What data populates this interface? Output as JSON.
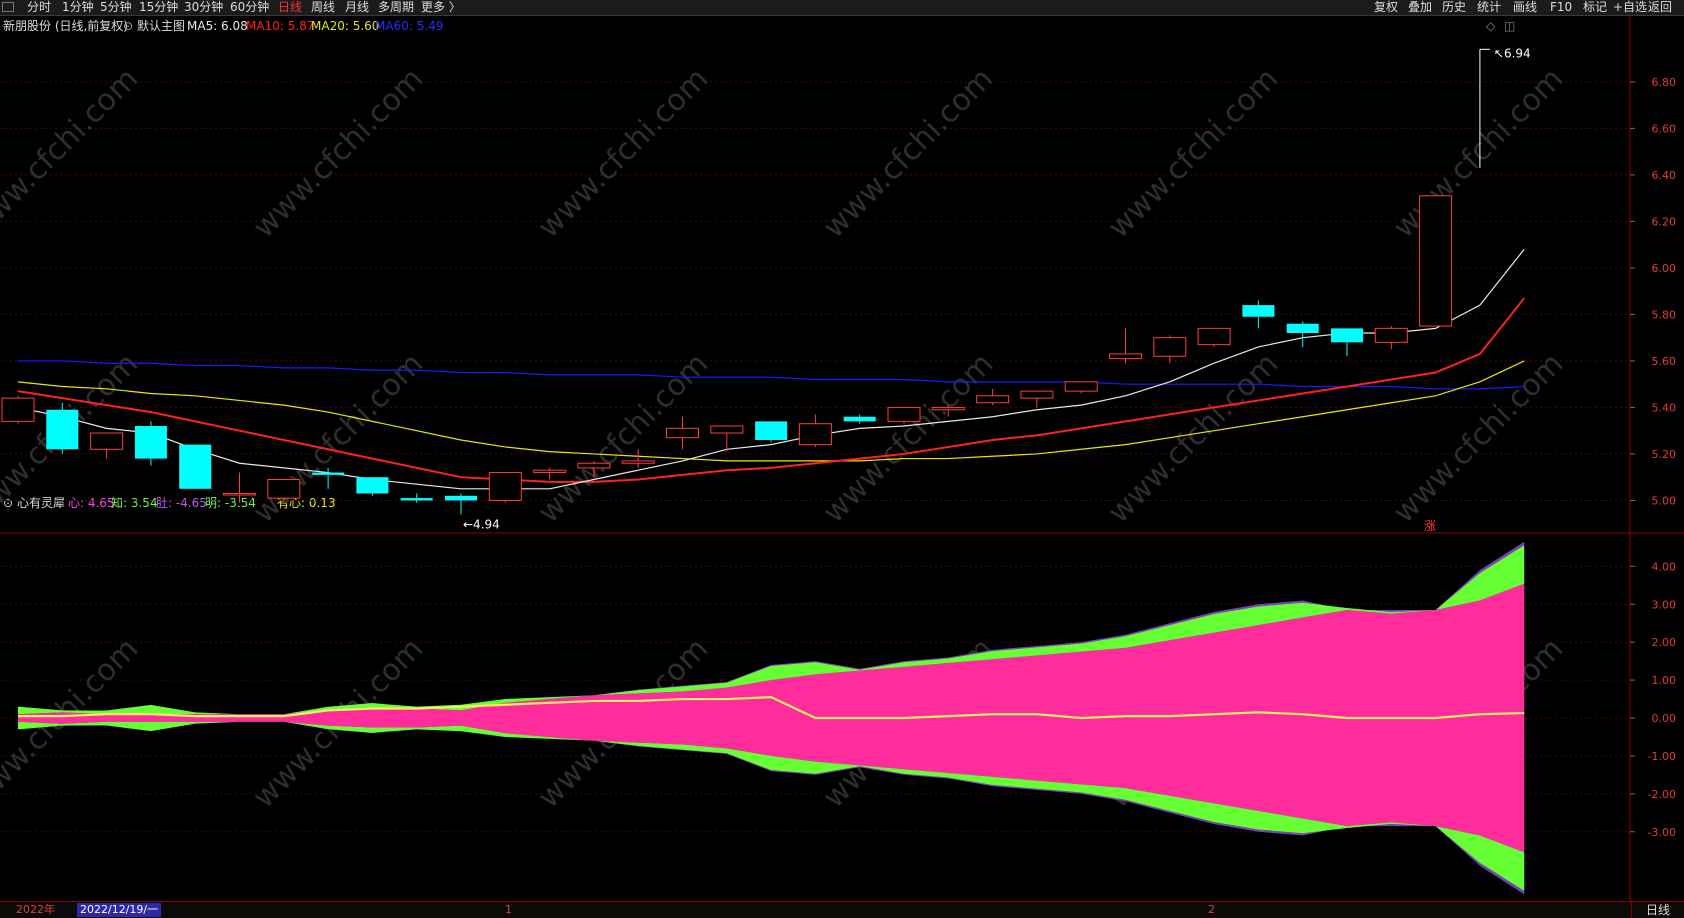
{
  "toolbar": {
    "left_items": [
      {
        "label": "分时",
        "active": false
      },
      {
        "label": "1分钟",
        "active": false
      },
      {
        "label": "5分钟",
        "active": false
      },
      {
        "label": "15分钟",
        "active": false
      },
      {
        "label": "30分钟",
        "active": false
      },
      {
        "label": "60分钟",
        "active": false
      },
      {
        "label": "日线",
        "active": true
      },
      {
        "label": "周线",
        "active": false
      },
      {
        "label": "月线",
        "active": false
      },
      {
        "label": "多周期",
        "active": false
      },
      {
        "label": "更多 〉",
        "active": false
      }
    ],
    "right_items": [
      "复权",
      "叠加",
      "历史",
      "统计",
      "画线",
      "F10",
      "标记",
      "+自选",
      "返回"
    ]
  },
  "main_chart": {
    "stock_label": "新朋股份 (日线,前复权)",
    "template_label": "默认主图",
    "ma5_label": "MA5: 6.08",
    "ma10_label": "MA10: 5.87",
    "ma20_label": "MA20: 5.60",
    "ma60_label": "MA60: 5.49",
    "high_marker": "6.94",
    "low_marker": "4.94",
    "rise_badge": "涨"
  },
  "indicator_panel": {
    "name": "心有灵犀",
    "xin_label": "心: 4.65",
    "zhi_label": "知: 3.54",
    "du_label": "肚: -4.65",
    "ming_label": "明: -3.54",
    "youxin_label": "有心: 0.13"
  },
  "watermark_text": "www.cfchi.com",
  "bottom_bar": {
    "year": "2022年",
    "date": "2022/12/19/一",
    "month_markers": [
      "1",
      "2"
    ],
    "period": "日线"
  },
  "colors": {
    "up": "#ff3c3c",
    "down": "#00ffff",
    "ma5": "#e8e8e8",
    "ma10": "#ff2020",
    "ma20": "#e8e800",
    "ma60": "#1a1aff",
    "magenta": "#ff2c9c",
    "purple": "#7b3fb8",
    "green": "#66ff33",
    "axis": "#e23c3c"
  },
  "chart_data": {
    "type": "candlestick",
    "price_axis": {
      "ticks": [
        "6.80",
        "6.60",
        "6.40",
        "6.20",
        "6.00",
        "5.80",
        "5.60",
        "5.40",
        "5.20",
        "5.00"
      ],
      "range": [
        4.86,
        6.98
      ]
    },
    "candles": [
      {
        "o": 5.34,
        "h": 5.45,
        "l": 5.33,
        "c": 5.44
      },
      {
        "o": 5.39,
        "h": 5.42,
        "l": 5.2,
        "c": 5.22
      },
      {
        "o": 5.22,
        "h": 5.29,
        "l": 5.18,
        "c": 5.29
      },
      {
        "o": 5.32,
        "h": 5.34,
        "l": 5.15,
        "c": 5.18
      },
      {
        "o": 5.24,
        "h": 5.24,
        "l": 5.05,
        "c": 5.05
      },
      {
        "o": 5.03,
        "h": 5.12,
        "l": 4.99,
        "c": 5.03
      },
      {
        "o": 5.01,
        "h": 5.09,
        "l": 5.0,
        "c": 5.09
      },
      {
        "o": 5.12,
        "h": 5.14,
        "l": 5.05,
        "c": 5.11
      },
      {
        "o": 5.1,
        "h": 5.1,
        "l": 5.02,
        "c": 5.03
      },
      {
        "o": 5.01,
        "h": 5.03,
        "l": 4.99,
        "c": 5.0
      },
      {
        "o": 5.02,
        "h": 5.03,
        "l": 4.94,
        "c": 5.0
      },
      {
        "o": 5.0,
        "h": 5.12,
        "l": 4.99,
        "c": 5.12
      },
      {
        "o": 5.12,
        "h": 5.14,
        "l": 5.09,
        "c": 5.13
      },
      {
        "o": 5.14,
        "h": 5.17,
        "l": 5.1,
        "c": 5.16
      },
      {
        "o": 5.16,
        "h": 5.22,
        "l": 5.14,
        "c": 5.17
      },
      {
        "o": 5.27,
        "h": 5.36,
        "l": 5.22,
        "c": 5.31
      },
      {
        "o": 5.29,
        "h": 5.32,
        "l": 5.21,
        "c": 5.32
      },
      {
        "o": 5.34,
        "h": 5.34,
        "l": 5.25,
        "c": 5.26
      },
      {
        "o": 5.24,
        "h": 5.37,
        "l": 5.23,
        "c": 5.33
      },
      {
        "o": 5.36,
        "h": 5.37,
        "l": 5.33,
        "c": 5.34
      },
      {
        "o": 5.34,
        "h": 5.4,
        "l": 5.33,
        "c": 5.4
      },
      {
        "o": 5.39,
        "h": 5.41,
        "l": 5.36,
        "c": 5.4
      },
      {
        "o": 5.42,
        "h": 5.48,
        "l": 5.41,
        "c": 5.45
      },
      {
        "o": 5.44,
        "h": 5.47,
        "l": 5.4,
        "c": 5.47
      },
      {
        "o": 5.47,
        "h": 5.51,
        "l": 5.46,
        "c": 5.51
      },
      {
        "o": 5.61,
        "h": 5.74,
        "l": 5.59,
        "c": 5.63
      },
      {
        "o": 5.62,
        "h": 5.71,
        "l": 5.59,
        "c": 5.7
      },
      {
        "o": 5.67,
        "h": 5.74,
        "l": 5.66,
        "c": 5.74
      },
      {
        "o": 5.84,
        "h": 5.86,
        "l": 5.74,
        "c": 5.79
      },
      {
        "o": 5.76,
        "h": 5.77,
        "l": 5.66,
        "c": 5.72
      },
      {
        "o": 5.74,
        "h": 5.74,
        "l": 5.62,
        "c": 5.68
      },
      {
        "o": 5.68,
        "h": 5.75,
        "l": 5.65,
        "c": 5.74
      },
      {
        "o": 5.75,
        "h": 6.31,
        "l": 5.75,
        "c": 6.31
      },
      {
        "o": 6.94,
        "h": 6.94,
        "l": 6.43,
        "c": 6.43
      }
    ],
    "ma5": [
      5.4,
      5.36,
      5.31,
      5.29,
      5.22,
      5.16,
      5.14,
      5.12,
      5.09,
      5.07,
      5.05,
      5.05,
      5.05,
      5.09,
      5.13,
      5.17,
      5.22,
      5.24,
      5.28,
      5.31,
      5.32,
      5.34,
      5.36,
      5.39,
      5.41,
      5.45,
      5.51,
      5.59,
      5.66,
      5.7,
      5.72,
      5.72,
      5.74,
      5.84,
      6.08
    ],
    "ma10": [
      5.47,
      5.44,
      5.41,
      5.38,
      5.34,
      5.3,
      5.26,
      5.22,
      5.18,
      5.14,
      5.1,
      5.09,
      5.08,
      5.08,
      5.09,
      5.11,
      5.13,
      5.14,
      5.16,
      5.18,
      5.2,
      5.23,
      5.26,
      5.28,
      5.31,
      5.34,
      5.37,
      5.4,
      5.43,
      5.46,
      5.49,
      5.52,
      5.55,
      5.63,
      5.87
    ],
    "ma20": [
      5.51,
      5.49,
      5.48,
      5.46,
      5.45,
      5.43,
      5.41,
      5.38,
      5.34,
      5.3,
      5.26,
      5.23,
      5.21,
      5.2,
      5.19,
      5.18,
      5.17,
      5.17,
      5.17,
      5.17,
      5.18,
      5.18,
      5.19,
      5.2,
      5.22,
      5.24,
      5.27,
      5.3,
      5.33,
      5.36,
      5.39,
      5.42,
      5.45,
      5.51,
      5.6
    ],
    "ma60": [
      5.6,
      5.6,
      5.59,
      5.59,
      5.58,
      5.58,
      5.57,
      5.57,
      5.56,
      5.56,
      5.55,
      5.55,
      5.54,
      5.54,
      5.54,
      5.53,
      5.53,
      5.53,
      5.52,
      5.52,
      5.52,
      5.51,
      5.51,
      5.51,
      5.51,
      5.5,
      5.5,
      5.5,
      5.5,
      5.49,
      5.49,
      5.49,
      5.48,
      5.48,
      5.49
    ],
    "indicator": {
      "axis_ticks": [
        "4.00",
        "3.00",
        "2.00",
        "1.00",
        "0.00",
        "-1.00",
        "-2.00",
        "-3.00"
      ],
      "range": [
        -4.8,
        4.8
      ],
      "xin": [
        0.1,
        0.15,
        0.2,
        0.35,
        0.15,
        0.1,
        0.1,
        0.3,
        0.4,
        0.25,
        0.2,
        0.4,
        0.5,
        0.6,
        0.75,
        0.85,
        0.95,
        1.4,
        1.5,
        1.3,
        1.5,
        1.6,
        1.8,
        1.9,
        2.0,
        2.2,
        2.5,
        2.8,
        3.0,
        3.1,
        2.85,
        2.85,
        2.85,
        3.9,
        4.65
      ],
      "zhi": [
        0.3,
        0.2,
        0.1,
        0.1,
        0.1,
        0.1,
        0.1,
        0.2,
        0.25,
        0.3,
        0.35,
        0.5,
        0.55,
        0.6,
        0.65,
        0.7,
        0.8,
        1.0,
        1.15,
        1.25,
        1.35,
        1.45,
        1.55,
        1.65,
        1.75,
        1.85,
        2.05,
        2.25,
        2.45,
        2.65,
        2.9,
        2.75,
        2.85,
        3.1,
        3.54
      ],
      "youxin": [
        0.05,
        0.05,
        0.1,
        0.1,
        0.05,
        0.05,
        0.05,
        0.2,
        0.25,
        0.25,
        0.3,
        0.35,
        0.4,
        0.45,
        0.45,
        0.5,
        0.5,
        0.55,
        0.0,
        0.0,
        0.0,
        0.05,
        0.1,
        0.1,
        0.0,
        0.05,
        0.05,
        0.1,
        0.15,
        0.1,
        0.0,
        0.0,
        0.0,
        0.1,
        0.13
      ]
    }
  }
}
